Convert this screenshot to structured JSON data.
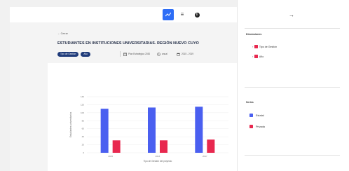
{
  "toolbar": {
    "buttons": [
      {
        "icon": "bar-chart-icon",
        "active": true
      },
      {
        "icon": "list-icon",
        "glyph": "≡",
        "active": false
      },
      {
        "icon": "info-icon",
        "glyph": "i",
        "active": false
      }
    ]
  },
  "header": {
    "back_label": "← Cerrar",
    "title": "ESTUDIANTES EN INSTITUCIONES UNIVERSITARIAS. REGIÓN NUEVO CUYO",
    "chips": [
      "Tipo de Gestión",
      "Año"
    ],
    "meta": [
      {
        "icon": "calendar-icon",
        "label": "Plan Estratégico 2030"
      },
      {
        "icon": "clock-icon",
        "label": "anual"
      },
      {
        "icon": "calendar-range-icon",
        "label": "2015 - 2019"
      }
    ]
  },
  "side_panel": {
    "collapse_arrow": "→",
    "dimensions": {
      "heading": "Dimensiones",
      "items": [
        "Tipo de Gestión",
        "Año"
      ]
    },
    "series": {
      "heading": "Series",
      "items": [
        {
          "label": "Estatal",
          "color": "#4a5ff0"
        },
        {
          "label": "Privada",
          "color": "#e8284f"
        }
      ]
    }
  },
  "colors": {
    "accent": "#2d6df6",
    "chip": "#1f3b7a",
    "series_blue": "#4a5ff0",
    "series_red": "#e8284f",
    "checkbox_red": "#e8284f"
  },
  "chart_data": {
    "type": "bar",
    "categories": [
      "2015",
      "2016",
      "2017"
    ],
    "series": [
      {
        "name": "Estatal",
        "values": [
          110,
          113,
          115
        ]
      },
      {
        "name": "Privada",
        "values": [
          31,
          31,
          33
        ]
      }
    ],
    "ylim": [
      0,
      140
    ],
    "yticks": [
      0,
      20,
      40,
      60,
      80,
      100,
      120,
      140
    ],
    "xlabel": "Tipo de Gestión del proyecto",
    "ylabel": "Estudiantes universitarios"
  }
}
